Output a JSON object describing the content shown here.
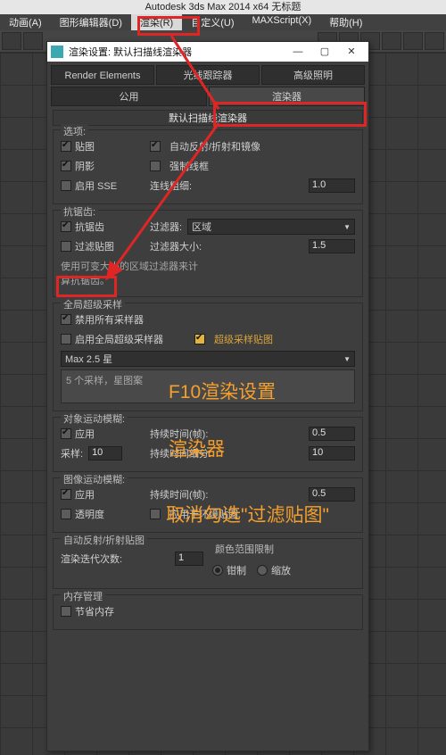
{
  "app": {
    "title": "Autodesk 3ds Max  2014 x64     无标题"
  },
  "menu": {
    "items": [
      "动画(A)",
      "图形编辑器(D)",
      "渲染(R)",
      "自定义(U)",
      "MAXScript(X)",
      "帮助(H)"
    ],
    "highlighted_index": 2
  },
  "dialog": {
    "title": "渲染设置: 默认扫描线渲染器",
    "win_min": "—",
    "win_max": "▢",
    "win_close": "✕",
    "tabs_row1": [
      "Render Elements",
      "光线跟踪器",
      "高级照明"
    ],
    "tabs_row2": [
      "公用",
      "渲染器"
    ],
    "active_tab": "渲染器",
    "rollup": "默认扫描线渲染器",
    "grp_options": {
      "title": "选项:",
      "mapping": "贴图",
      "auto_reflect": "自动反射/折射和镜像",
      "shadow": "阴影",
      "force_wire": "强制线框",
      "enable_sse": "启用 SSE",
      "wire_thickness": "连线粗细:",
      "wire_thickness_val": "1.0"
    },
    "grp_aa": {
      "title": "抗锯齿:",
      "antialias": "抗锯齿",
      "filter_maps": "过滤贴图",
      "filter": "过滤器:",
      "filter_value": "区域",
      "filter_size": "过滤器大小:",
      "filter_size_val": "1.5",
      "desc": "使用可变大小的区域过滤器来计算抗锯齿。"
    },
    "grp_ss": {
      "title": "全局超级采样",
      "disable_samplers": "禁用所有采样器",
      "enable_global": "启用全局超级采样器",
      "ss_maps": "超级采样贴图",
      "method": "Max 2.5 星",
      "desc": "5 个采样，星图案"
    },
    "grp_objblur": {
      "title": "对象运动模糊:",
      "apply": "应用",
      "samples": "采样:",
      "samples_val": "10",
      "duration": "持续时间(帧):",
      "duration_val": "0.5",
      "subdiv": "持续时间细分:",
      "subdiv_val": "10"
    },
    "grp_imgblur": {
      "title": "图像运动模糊:",
      "apply": "应用",
      "transparency": "透明度",
      "duration": "持续时间(帧):",
      "duration_val": "0.5",
      "apply_env": "应用于环境贴图"
    },
    "grp_autoref": {
      "title": "自动反射/折射贴图",
      "iter": "渲染迭代次数:",
      "iter_val": "1",
      "color_range": "颜色范围限制",
      "clamp": "钳制",
      "scale": "缩放"
    },
    "grp_mem": {
      "title": "内存管理",
      "conserve": "节省内存"
    }
  },
  "annot": {
    "line1": "F10渲染设置",
    "line2": "渲染器",
    "line3": "取消勾选\"过滤贴图\""
  }
}
